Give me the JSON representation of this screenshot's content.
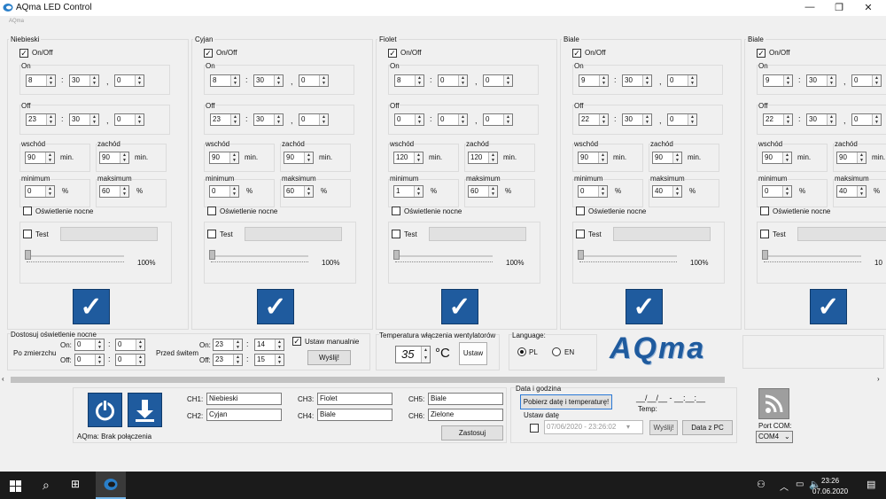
{
  "window": {
    "title": "AQma LED Control",
    "menu_hint": "AQma"
  },
  "channels": [
    {
      "name": "Niebieski",
      "onoff": "On/Off",
      "on_label": "On",
      "on": [
        "8",
        "30",
        "0"
      ],
      "off_label": "Off",
      "off": [
        "23",
        "30",
        "0"
      ],
      "wschod_label": "wschód",
      "wschod": "90",
      "zachod_label": "zachód",
      "zachod": "90",
      "min_unit": "min.",
      "minimum_label": "minimum",
      "minimum": "0",
      "maksimum_label": "maksimum",
      "maksimum": "60",
      "pct": "%",
      "night": "Oświetlenie nocne",
      "test": "Test",
      "level": "100%"
    },
    {
      "name": "Cyjan",
      "onoff": "On/Off",
      "on_label": "On",
      "on": [
        "8",
        "30",
        "0"
      ],
      "off_label": "Off",
      "off": [
        "23",
        "30",
        "0"
      ],
      "wschod_label": "wschód",
      "wschod": "90",
      "zachod_label": "zachód",
      "zachod": "90",
      "min_unit": "min.",
      "minimum_label": "minimum",
      "minimum": "0",
      "maksimum_label": "maksimum",
      "maksimum": "60",
      "pct": "%",
      "night": "Oświetlenie nocne",
      "test": "Test",
      "level": "100%"
    },
    {
      "name": "Fiolet",
      "onoff": "On/Off",
      "on_label": "On",
      "on": [
        "8",
        "0",
        "0"
      ],
      "off_label": "Off",
      "off": [
        "0",
        "0",
        "0"
      ],
      "wschod_label": "wschód",
      "wschod": "120",
      "zachod_label": "zachód",
      "zachod": "120",
      "min_unit": "min.",
      "minimum_label": "minimum",
      "minimum": "1",
      "maksimum_label": "maksimum",
      "maksimum": "60",
      "pct": "%",
      "night": "Oświetlenie nocne",
      "test": "Test",
      "level": "100%"
    },
    {
      "name": "Biale",
      "onoff": "On/Off",
      "on_label": "On",
      "on": [
        "9",
        "30",
        "0"
      ],
      "off_label": "Off",
      "off": [
        "22",
        "30",
        "0"
      ],
      "wschod_label": "wschód",
      "wschod": "90",
      "zachod_label": "zachód",
      "zachod": "90",
      "min_unit": "min.",
      "minimum_label": "minimum",
      "minimum": "0",
      "maksimum_label": "maksimum",
      "maksimum": "40",
      "pct": "%",
      "night": "Oświetlenie nocne",
      "test": "Test",
      "level": "100%"
    },
    {
      "name": "Biale",
      "onoff": "On/Off",
      "on_label": "On",
      "on": [
        "9",
        "30",
        "0"
      ],
      "off_label": "Off",
      "off": [
        "22",
        "30",
        "0"
      ],
      "wschod_label": "wschód",
      "wschod": "90",
      "zachod_label": "zachód",
      "zachod": "90",
      "min_unit": "min.",
      "minimum_label": "minimum",
      "minimum": "0",
      "maksimum_label": "maksimum",
      "maksimum": "40",
      "pct": "%",
      "night": "Oświetlenie nocne",
      "test": "Test",
      "level": "10"
    }
  ],
  "night": {
    "title": "Dostosuj oświetlenie nocne",
    "after_sunset": "Po zmierzchu",
    "before_sunrise": "Przed świtem",
    "on_label": "On:",
    "off_label": "Off:",
    "ps_on": [
      "0",
      "0"
    ],
    "ps_off": [
      "0",
      "0"
    ],
    "pw_on": [
      "23",
      "14"
    ],
    "pw_off": [
      "23",
      "15"
    ],
    "manual": "Ustaw manualnie",
    "send": "Wyślij!"
  },
  "fan": {
    "title": "Temperatura włączenia wentylatorów",
    "temp": "35",
    "unit": "°C",
    "set": "Ustaw"
  },
  "language": {
    "title": "Language:",
    "pl": "PL",
    "en": "EN"
  },
  "logo": "AQma",
  "bottom": {
    "status": "AQma: Brak połączenia",
    "ch": [
      {
        "label": "CH1:",
        "value": "Niebieski"
      },
      {
        "label": "CH2:",
        "value": "Cyjan"
      },
      {
        "label": "CH3:",
        "value": "Fiolet"
      },
      {
        "label": "CH4:",
        "value": "Biale"
      },
      {
        "label": "CH5:",
        "value": "Biale"
      },
      {
        "label": "CH6:",
        "value": "Zielone"
      }
    ],
    "apply": "Zastosuj"
  },
  "datetime": {
    "title": "Data i godzina",
    "fetch": "Pobierz datę i temperaturę!",
    "date_placeholder": "__/__/__ - __:__:__",
    "temp_label": "Temp:",
    "set_title": "Ustaw datę",
    "date_value": "07/06/2020 - 23:26:02",
    "send": "Wyślij!",
    "from_pc": "Data z PC"
  },
  "port": {
    "label": "Port COM:",
    "value": "COM4"
  },
  "taskbar": {
    "time": "23:26",
    "date": "07.06.2020"
  }
}
